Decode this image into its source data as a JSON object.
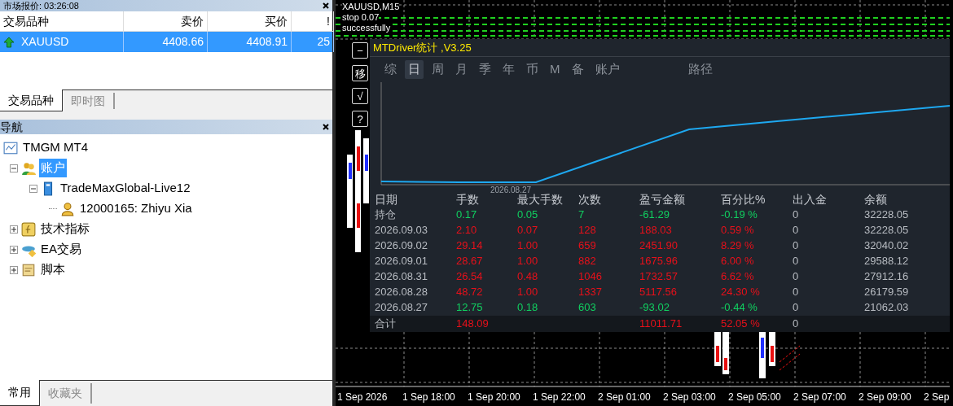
{
  "market_watch": {
    "title": "市场报价: 03:26:08",
    "columns": [
      "交易品种",
      "卖价",
      "买价",
      "!"
    ],
    "rows": [
      {
        "symbol": "XAUUSD",
        "bid": "4408.66",
        "ask": "4408.91",
        "spread": "25",
        "selected": true
      }
    ],
    "tabs": [
      {
        "label": "交易品种",
        "selected": true
      },
      {
        "label": "即时图",
        "selected": false
      }
    ]
  },
  "navigator": {
    "title": "导航",
    "tree": [
      {
        "label": "TMGM MT4",
        "kind": "terminal",
        "selected": false,
        "children": [
          {
            "label": "账户",
            "kind": "accounts",
            "expanded": true,
            "selected": true,
            "children": [
              {
                "label": "TradeMaxGlobal-Live12",
                "kind": "server",
                "expanded": true,
                "selected": false,
                "children": [
                  {
                    "label": "12000165: Zhiyu Xia",
                    "kind": "user",
                    "selected": false
                  }
                ]
              }
            ]
          },
          {
            "label": "技术指标",
            "kind": "indicators",
            "expanded": false,
            "selected": false
          },
          {
            "label": "EA交易",
            "kind": "experts",
            "expanded": false,
            "selected": false
          },
          {
            "label": "脚本",
            "kind": "scripts",
            "expanded": false,
            "selected": false
          }
        ]
      }
    ],
    "tabs": [
      {
        "label": "常用",
        "selected": true
      },
      {
        "label": "收藏夹",
        "selected": false
      }
    ]
  },
  "chart": {
    "overlay_texts": [
      "XAUUSD,M15",
      "stop 0.07",
      "successfully"
    ],
    "side_buttons": [
      "−",
      "移",
      "√",
      "?"
    ],
    "time_axis": [
      "1 Sep 2026",
      "1 Sep 18:00",
      "1 Sep 20:00",
      "1 Sep 22:00",
      "2 Sep 01:00",
      "2 Sep 03:00",
      "2 Sep 05:00",
      "2 Sep 07:00",
      "2 Sep 09:00",
      "2 Sep"
    ]
  },
  "stats_panel": {
    "title": "MTDriver统计 ,V3.25",
    "tabs": [
      {
        "label": "综",
        "selected": false
      },
      {
        "label": "日",
        "selected": true
      },
      {
        "label": "周",
        "selected": false
      },
      {
        "label": "月",
        "selected": false
      },
      {
        "label": "季",
        "selected": false
      },
      {
        "label": "年",
        "selected": false
      },
      {
        "label": "币",
        "selected": false
      },
      {
        "label": "M",
        "selected": false
      },
      {
        "label": "备",
        "selected": false
      },
      {
        "label": "账户",
        "selected": false
      },
      {
        "label": "路径",
        "selected": false
      }
    ],
    "equity_chart": {
      "start_label": "2026.08.27"
    },
    "columns": [
      "日期",
      "手数",
      "最大手数",
      "次数",
      "盈亏金额",
      "百分比%",
      "出入金",
      "余额"
    ],
    "rows": [
      {
        "date": "持仓",
        "lots": "0.17",
        "max_lots": "0.05",
        "count": "7",
        "pnl": "-61.29",
        "percent": "-0.19 %",
        "deposit": "0",
        "balance": "32228.05",
        "color": "#10d060"
      },
      {
        "date": "2026.09.03",
        "lots": "2.10",
        "max_lots": "0.07",
        "count": "128",
        "pnl": "188.03",
        "percent": "0.59 %",
        "deposit": "0",
        "balance": "32228.05",
        "color": "#e8101a"
      },
      {
        "date": "2026.09.02",
        "lots": "29.14",
        "max_lots": "1.00",
        "count": "659",
        "pnl": "2451.90",
        "percent": "8.29 %",
        "deposit": "0",
        "balance": "32040.02",
        "color": "#e8101a"
      },
      {
        "date": "2026.09.01",
        "lots": "28.67",
        "max_lots": "1.00",
        "count": "882",
        "pnl": "1675.96",
        "percent": "6.00 %",
        "deposit": "0",
        "balance": "29588.12",
        "color": "#e8101a"
      },
      {
        "date": "2026.08.31",
        "lots": "26.54",
        "max_lots": "0.48",
        "count": "1046",
        "pnl": "1732.57",
        "percent": "6.62 %",
        "deposit": "0",
        "balance": "27912.16",
        "color": "#e8101a"
      },
      {
        "date": "2026.08.28",
        "lots": "48.72",
        "max_lots": "1.00",
        "count": "1337",
        "pnl": "5117.56",
        "percent": "24.30 %",
        "deposit": "0",
        "balance": "26179.59",
        "color": "#e8101a"
      },
      {
        "date": "2026.08.27",
        "lots": "12.75",
        "max_lots": "0.18",
        "count": "603",
        "pnl": "-93.02",
        "percent": "-0.44 %",
        "deposit": "0",
        "balance": "21062.03",
        "color": "#10d060"
      }
    ],
    "total": {
      "label": "合计",
      "lots": "148.09",
      "pnl": "11011.71",
      "percent": "52.05 %",
      "deposit": "0",
      "color": "#e8101a"
    }
  }
}
